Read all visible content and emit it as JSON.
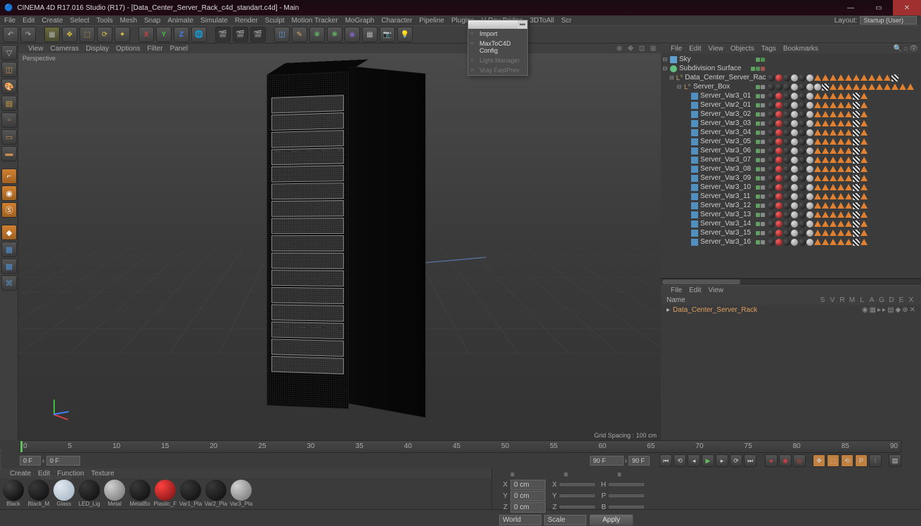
{
  "title": "CINEMA 4D R17.016 Studio (R17) - [Data_Center_Server_Rack_c4d_standart.c4d] - Main",
  "menubar": [
    "File",
    "Edit",
    "Create",
    "Select",
    "Tools",
    "Mesh",
    "Snap",
    "Animate",
    "Simulate",
    "Render",
    "Sculpt",
    "Motion Tracker",
    "MoGraph",
    "Character",
    "Pipeline",
    "Plugins",
    "V-Ray Bridge",
    "3DToAll",
    "Scr"
  ],
  "layout_label": "Layout:",
  "layout_value": "Startup (User)",
  "popup": {
    "items": [
      {
        "label": "Import",
        "enabled": true
      },
      {
        "label": "MaxToC4D Config",
        "enabled": true
      },
      {
        "label": "Light Manager",
        "enabled": false
      },
      {
        "label": "Vray FastPrev",
        "enabled": false
      }
    ]
  },
  "viewport": {
    "menu": [
      "View",
      "Cameras",
      "Display",
      "Options",
      "Filter",
      "Panel"
    ],
    "label": "Perspective",
    "grid_spacing": "Grid Spacing : 100 cm"
  },
  "obj_menu": [
    "File",
    "Edit",
    "View",
    "Objects",
    "Tags",
    "Bookmarks"
  ],
  "objects": [
    {
      "name": "Sky",
      "level": 0,
      "icon": "sky",
      "dots": [
        "g",
        "g2"
      ]
    },
    {
      "name": "Subdivision Surface",
      "level": 0,
      "icon": "sds",
      "dots": [
        "g",
        "g2",
        "r"
      ]
    },
    {
      "name": "Data_Center_Server_Rack",
      "level": 1,
      "icon": "lo",
      "dots": [
        "g",
        "gy"
      ]
    },
    {
      "name": "Server_Box",
      "level": 2,
      "icon": "lo",
      "dots": [
        "g",
        "gy"
      ]
    },
    {
      "name": "Server_Var3_01",
      "level": 3,
      "icon": "poly",
      "dots": [
        "g",
        "gy"
      ]
    },
    {
      "name": "Server_Var2_01",
      "level": 3,
      "icon": "poly",
      "dots": [
        "g",
        "gy"
      ]
    },
    {
      "name": "Server_Var3_02",
      "level": 3,
      "icon": "poly",
      "dots": [
        "g",
        "gy"
      ]
    },
    {
      "name": "Server_Var3_03",
      "level": 3,
      "icon": "poly",
      "dots": [
        "g",
        "gy"
      ]
    },
    {
      "name": "Server_Var3_04",
      "level": 3,
      "icon": "poly",
      "dots": [
        "g",
        "gy"
      ]
    },
    {
      "name": "Server_Var3_05",
      "level": 3,
      "icon": "poly",
      "dots": [
        "g",
        "gy"
      ]
    },
    {
      "name": "Server_Var3_06",
      "level": 3,
      "icon": "poly",
      "dots": [
        "g",
        "gy"
      ]
    },
    {
      "name": "Server_Var3_07",
      "level": 3,
      "icon": "poly",
      "dots": [
        "g",
        "gy"
      ]
    },
    {
      "name": "Server_Var3_08",
      "level": 3,
      "icon": "poly",
      "dots": [
        "g",
        "gy"
      ]
    },
    {
      "name": "Server_Var3_09",
      "level": 3,
      "icon": "poly",
      "dots": [
        "g",
        "gy"
      ]
    },
    {
      "name": "Server_Var3_10",
      "level": 3,
      "icon": "poly",
      "dots": [
        "g",
        "gy"
      ]
    },
    {
      "name": "Server_Var3_11",
      "level": 3,
      "icon": "poly",
      "dots": [
        "g",
        "gy"
      ]
    },
    {
      "name": "Server_Var3_12",
      "level": 3,
      "icon": "poly",
      "dots": [
        "g",
        "gy"
      ]
    },
    {
      "name": "Server_Var3_13",
      "level": 3,
      "icon": "poly",
      "dots": [
        "g",
        "gy"
      ]
    },
    {
      "name": "Server_Var3_14",
      "level": 3,
      "icon": "poly",
      "dots": [
        "g",
        "gy"
      ]
    },
    {
      "name": "Server_Var3_15",
      "level": 3,
      "icon": "poly",
      "dots": [
        "g",
        "gy"
      ]
    },
    {
      "name": "Server_Var3_16",
      "level": 3,
      "icon": "poly",
      "dots": [
        "g",
        "gy"
      ]
    }
  ],
  "attr_menu": [
    "File",
    "Edit",
    "View"
  ],
  "attr_name_label": "Name",
  "attr_cols": [
    "S",
    "V",
    "R",
    "M",
    "L",
    "A",
    "G",
    "D",
    "E",
    "X"
  ],
  "take_name": "Data_Center_Server_Rack",
  "ruler_ticks": [
    "0",
    "5",
    "10",
    "15",
    "20",
    "25",
    "30",
    "35",
    "40",
    "45",
    "50",
    "55",
    "60",
    "65",
    "70",
    "75",
    "80",
    "85",
    "90"
  ],
  "time_start": "0 F",
  "time_cur": "0 F",
  "time_end": "90 F",
  "time_max": "90 F",
  "mat_menu": [
    "Create",
    "Edit",
    "Function",
    "Texture"
  ],
  "materials": [
    {
      "name": "Black",
      "cls": "black"
    },
    {
      "name": "Black_M",
      "cls": "dark"
    },
    {
      "name": "Glass",
      "cls": "glass"
    },
    {
      "name": "LED_Lig",
      "cls": "dark"
    },
    {
      "name": "Metal",
      "cls": "metal"
    },
    {
      "name": "MetalBo",
      "cls": "dark"
    },
    {
      "name": "Plastic_F",
      "cls": "red"
    },
    {
      "name": "Var1_Pla",
      "cls": "dark"
    },
    {
      "name": "Var2_Pla",
      "cls": "dark"
    },
    {
      "name": "Var3_Pla",
      "cls": "metal"
    }
  ],
  "coords": {
    "x": {
      "p": "0 cm",
      "s": "X",
      "h": "H",
      "pv": "0 cm",
      "sv": "",
      "hv": ""
    },
    "y": {
      "p": "0 cm",
      "s": "Y",
      "h": "P",
      "pv": "0 cm"
    },
    "z": {
      "p": "0 cm",
      "s": "Z",
      "h": "B",
      "pv": "0 cm"
    },
    "world": "World",
    "scale": "Scale",
    "apply": "Apply"
  }
}
